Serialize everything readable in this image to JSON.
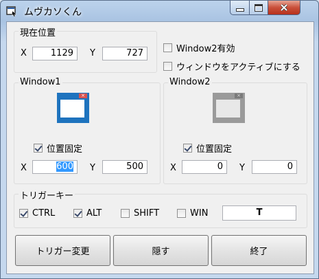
{
  "window": {
    "title": "ムヴカソくん"
  },
  "colors": {
    "accent_blue": "#1e73be",
    "disabled_gray": "#9a9a9a",
    "close_red": "#c9503a"
  },
  "position_group": {
    "label": "現在位置",
    "x_label": "X",
    "x_value": "1129",
    "y_label": "Y",
    "y_value": "727"
  },
  "options": {
    "window2_enabled": {
      "label": "Window2有効",
      "checked": false
    },
    "activate_window": {
      "label": "ウィンドウをアクティブにする",
      "checked": false
    }
  },
  "window1": {
    "label": "Window1",
    "preview_icon": "window-icon",
    "fix_label": "位置固定",
    "fix_checked": true,
    "x_label": "X",
    "x_value": "600",
    "y_label": "Y",
    "y_value": "500"
  },
  "window2": {
    "label": "Window2",
    "preview_icon": "window-icon",
    "fix_label": "位置固定",
    "fix_checked": true,
    "x_label": "X",
    "x_value": "0",
    "y_label": "Y",
    "y_value": "0"
  },
  "trigger": {
    "label": "トリガーキー",
    "ctrl": {
      "label": "CTRL",
      "checked": true
    },
    "alt": {
      "label": "ALT",
      "checked": true
    },
    "shift": {
      "label": "SHIFT",
      "checked": false
    },
    "win": {
      "label": "WIN",
      "checked": false
    },
    "key_value": "T"
  },
  "buttons": {
    "change_trigger": "トリガー変更",
    "hide": "隠す",
    "exit": "終了"
  }
}
